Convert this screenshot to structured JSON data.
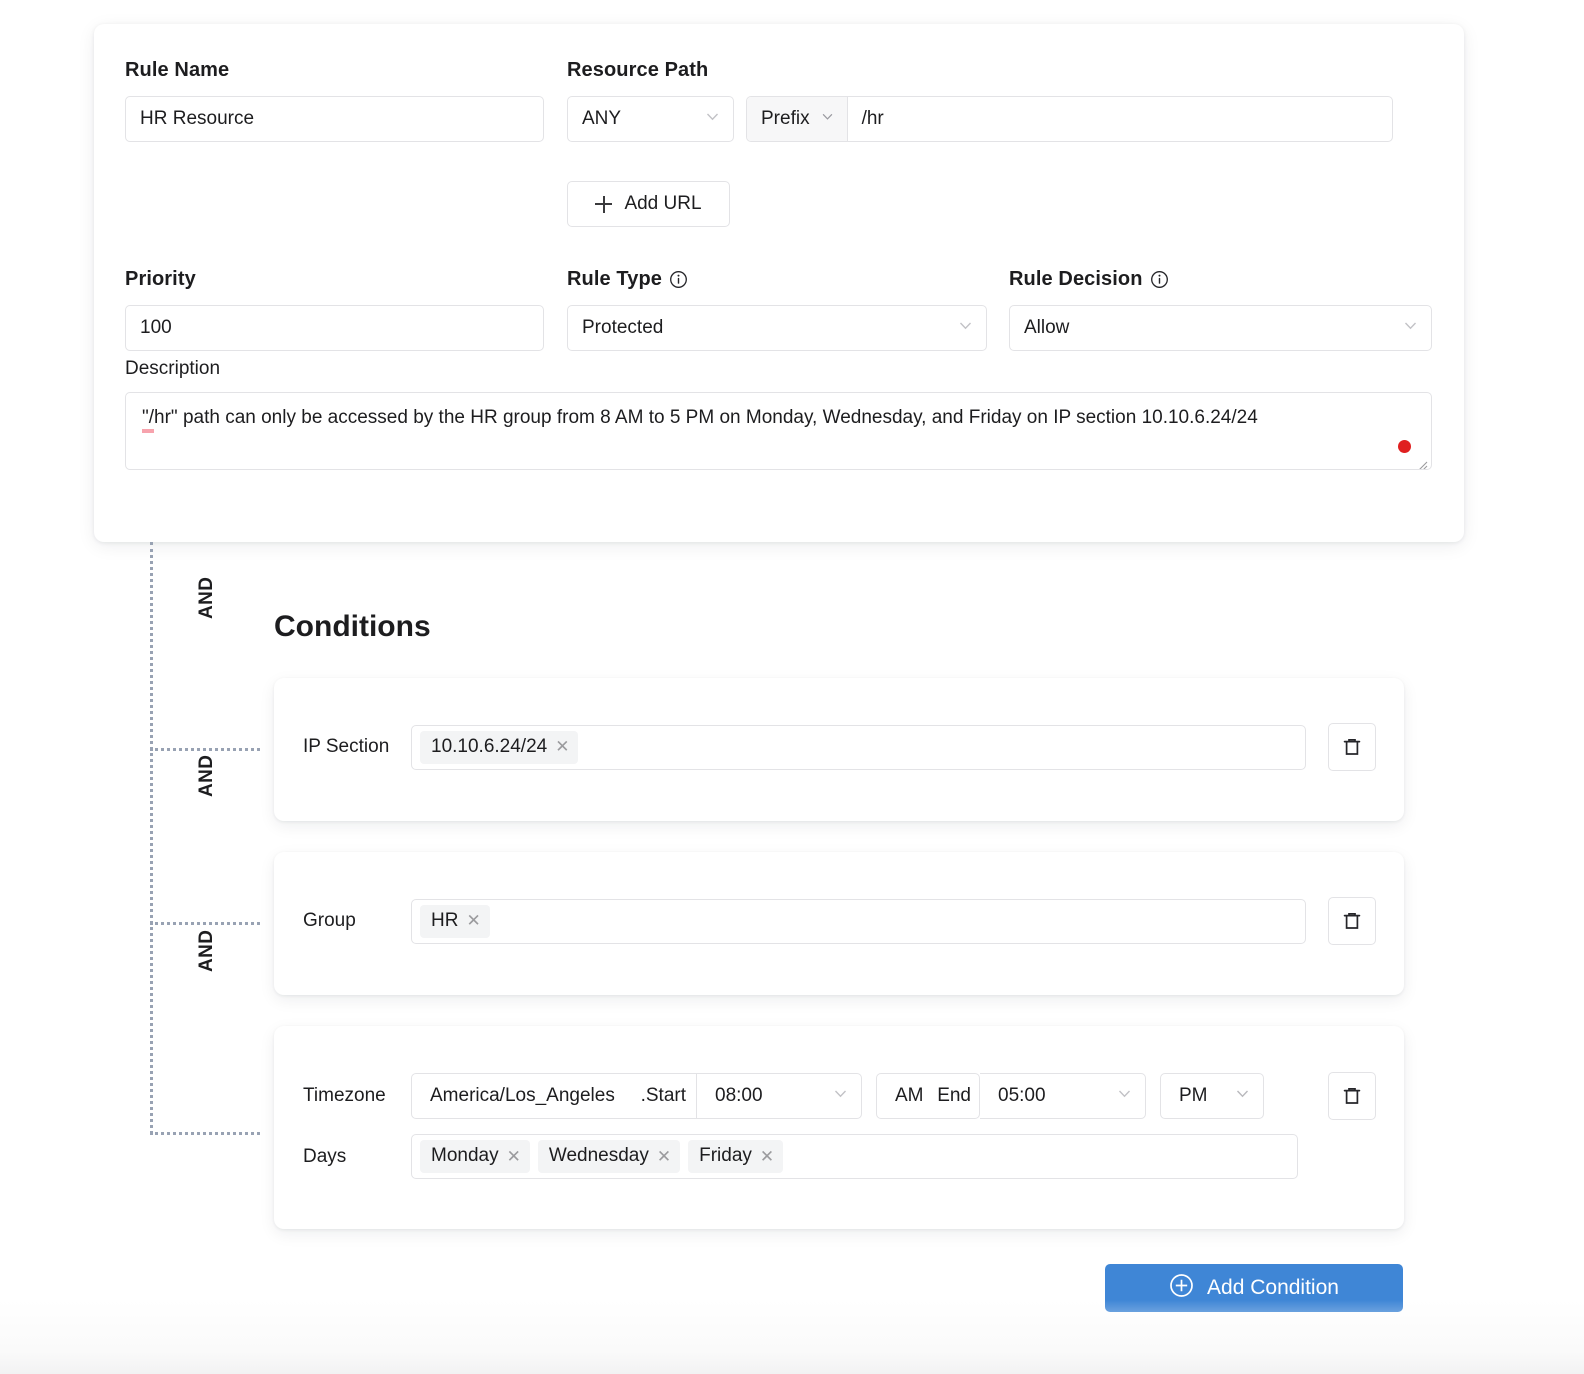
{
  "rule": {
    "rule_name_label": "Rule Name",
    "rule_name_value": "HR Resource",
    "resource_path_label": "Resource Path",
    "method_value": "ANY",
    "path_kind_value": "Prefix",
    "path_value": "/hr",
    "add_url_label": "Add URL",
    "priority_label": "Priority",
    "priority_value": "100",
    "rule_type_label": "Rule Type",
    "rule_type_value": "Protected",
    "rule_decision_label": "Rule Decision",
    "rule_decision_value": "Allow",
    "description_label": "Description",
    "description_lead": "\"/",
    "description_rest": "hr\" path can only be accessed by the HR group from 8 AM to 5 PM on Monday, Wednesday, and Friday on IP section 10.10.6.24/24"
  },
  "conditions": {
    "title": "Conditions",
    "operator_label": "AND",
    "ip_section": {
      "label": "IP Section",
      "tags": [
        "10.10.6.24/24"
      ]
    },
    "group": {
      "label": "Group",
      "tags": [
        "HR"
      ]
    },
    "schedule": {
      "timezone_label": "Timezone",
      "timezone_value": "America/Los_Angeles",
      "start_label": ".Start",
      "start_time": "08:00",
      "start_meridiem": "AM",
      "end_label": "End",
      "end_time": "05:00",
      "end_meridiem": "PM",
      "days_label": "Days",
      "days": [
        "Monday",
        "Wednesday",
        "Friday"
      ]
    },
    "add_condition_label": "Add Condition"
  },
  "colors": {
    "accent": "#3f86d6",
    "dot": "#e02020",
    "connector": "#98a2b3",
    "spellcheck": "#f7a3ad"
  }
}
